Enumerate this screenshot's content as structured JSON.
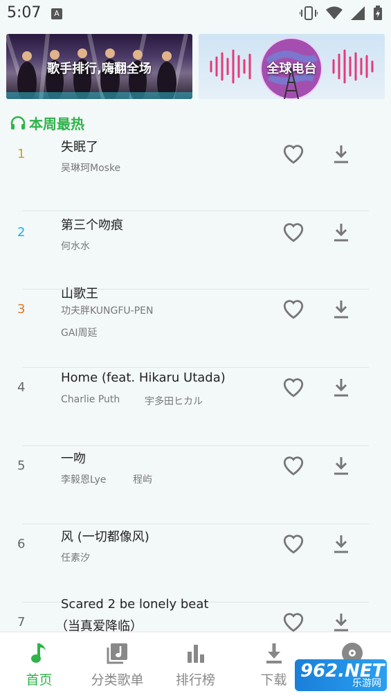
{
  "status_bar": {
    "time": "5:07",
    "notif_icon": "A"
  },
  "banners": [
    {
      "label": "歌手排行,嗨翻全场"
    },
    {
      "label": "全球电台"
    }
  ],
  "section": {
    "title": "本周最热",
    "icon": "headphones-icon"
  },
  "songs": [
    {
      "rank": "1",
      "rank_color": "#d4a017",
      "title": "失眠了",
      "artists": [
        "吴琳珂Moske"
      ]
    },
    {
      "rank": "2",
      "rank_color": "#1eaee8",
      "title": "第三个吻痕",
      "artists": [
        "何水水"
      ]
    },
    {
      "rank": "3",
      "rank_color": "#d67a26",
      "title": "山歌王",
      "artists": [
        "功夫胖KUNGFU-PEN",
        "GAI周延"
      ]
    },
    {
      "rank": "4",
      "rank_color": "#666666",
      "title": "Home (feat. Hikaru Utada)",
      "artists": [
        "Charlie Puth",
        "宇多田ヒカル"
      ]
    },
    {
      "rank": "5",
      "rank_color": "#666666",
      "title": "一吻",
      "artists": [
        "李毅恩Lye",
        "程屿"
      ]
    },
    {
      "rank": "6",
      "rank_color": "#666666",
      "title": "风 (一切都像风)",
      "artists": [
        "任素汐"
      ]
    },
    {
      "rank": "7",
      "rank_color": "#666666",
      "title": "Scared 2 be lonely beat",
      "title2": "（当真爱降临）",
      "artists": []
    }
  ],
  "nav": [
    {
      "label": "首页",
      "icon": "music-note-icon",
      "active": true
    },
    {
      "label": "分类歌单",
      "icon": "album-icon",
      "active": false
    },
    {
      "label": "排行榜",
      "icon": "bar-chart-icon",
      "active": false
    },
    {
      "label": "下载",
      "icon": "download-icon",
      "active": false
    },
    {
      "label": "",
      "icon": "disc-icon",
      "active": false
    }
  ],
  "watermark": {
    "big": "962.NET",
    "small": "乐游网"
  },
  "colors": {
    "accent": "#2fb34a",
    "icon": "#888888"
  }
}
